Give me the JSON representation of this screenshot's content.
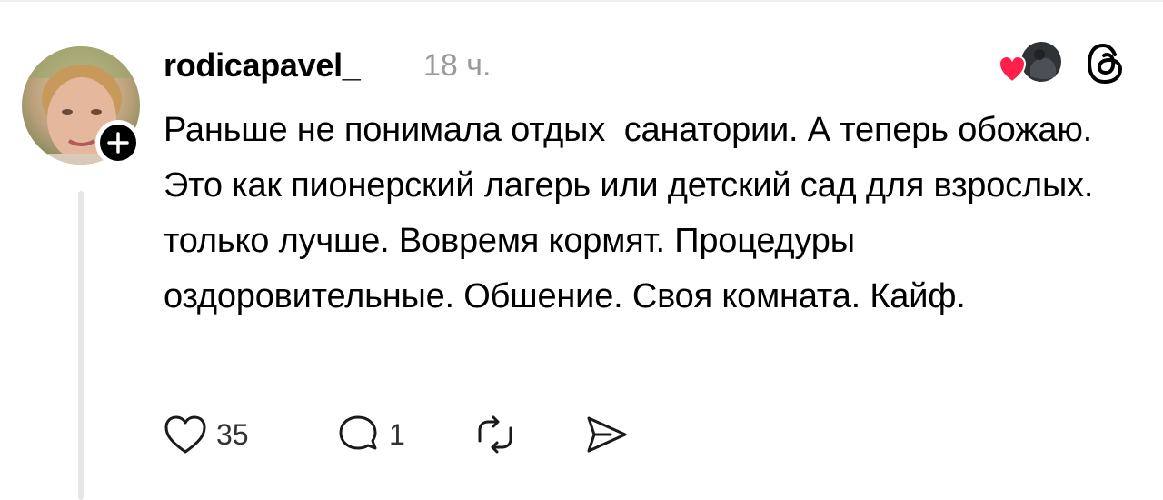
{
  "post": {
    "username": "rodicapavel_",
    "time": "18 ч.",
    "text": "Раньше не понимала отдых  санатории. А теперь обожаю. Это как пионерский лагерь или детский сад для взрослых. только лучше. Вовремя кормят. Процедуры оздоровительные. Обшение. Своя комната. Кайф."
  },
  "actions": {
    "like_count": "35",
    "reply_count": "1"
  },
  "colors": {
    "heart": "#ff1f4b",
    "timestamp": "#9a9a9a",
    "thread_line": "#e6e6e6"
  },
  "icons": [
    "plus-icon",
    "liked-heart-icon",
    "threads-logo-icon",
    "heart-icon",
    "comment-icon",
    "repost-icon",
    "share-icon"
  ]
}
